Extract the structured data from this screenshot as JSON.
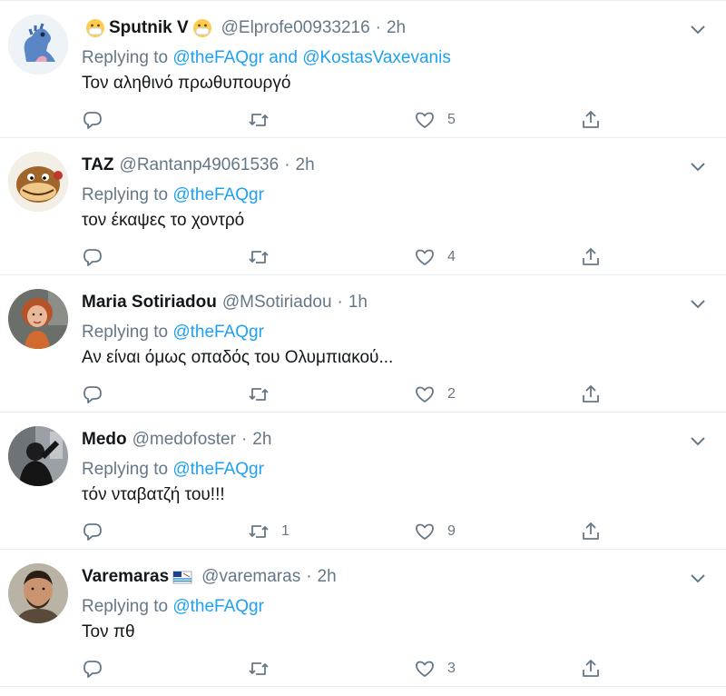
{
  "replying_label": "Replying to",
  "and_label": "and",
  "colors": {
    "link": "#1da1f2",
    "secondary_text": "#657786",
    "border": "#e6ecf0",
    "primary_text": "#14171a"
  },
  "tweets": [
    {
      "name": "Sputnik V",
      "name_emojis": [
        "mask-face-emoji",
        "mask-face-emoji"
      ],
      "handle": "@Elprofe00933216",
      "time": "2h",
      "replying_to": [
        "@theFAQgr",
        "@KostasVaxevanis"
      ],
      "text": "Τον αληθινό πρωθυπουργό",
      "replies": "",
      "retweets": "",
      "likes": "5",
      "avatar_icon": "blue-dinosaur-avatar"
    },
    {
      "name": "TAZ",
      "handle": "@Rantanp49061536",
      "time": "2h",
      "replying_to": [
        "@theFAQgr"
      ],
      "text": "τον έκαψες το χοντρό",
      "replies": "",
      "retweets": "",
      "likes": "4",
      "avatar_icon": "taz-cartoon-avatar"
    },
    {
      "name": "Maria Sotiriadou",
      "handle": "@MSotiriadou",
      "time": "1h",
      "replying_to": [
        "@theFAQgr"
      ],
      "text": "Αν είναι όμως οπαδός του Ολυμπιακού...",
      "replies": "",
      "retweets": "",
      "likes": "2",
      "avatar_icon": "woman-photo-avatar"
    },
    {
      "name": "Medo",
      "handle": "@medofoster",
      "time": "2h",
      "replying_to": [
        "@theFAQgr"
      ],
      "text": "τόν νταβατζή του!!!",
      "replies": "",
      "retweets": "1",
      "likes": "9",
      "avatar_icon": "dark-figure-photo-avatar"
    },
    {
      "name": "Varemaras",
      "name_emojis": [
        "flag-emoji"
      ],
      "handle": "@varemaras",
      "time": "2h",
      "replying_to": [
        "@theFAQgr"
      ],
      "text": "Τον πθ",
      "replies": "",
      "retweets": "",
      "likes": "3",
      "avatar_icon": "man-photo-avatar"
    }
  ]
}
